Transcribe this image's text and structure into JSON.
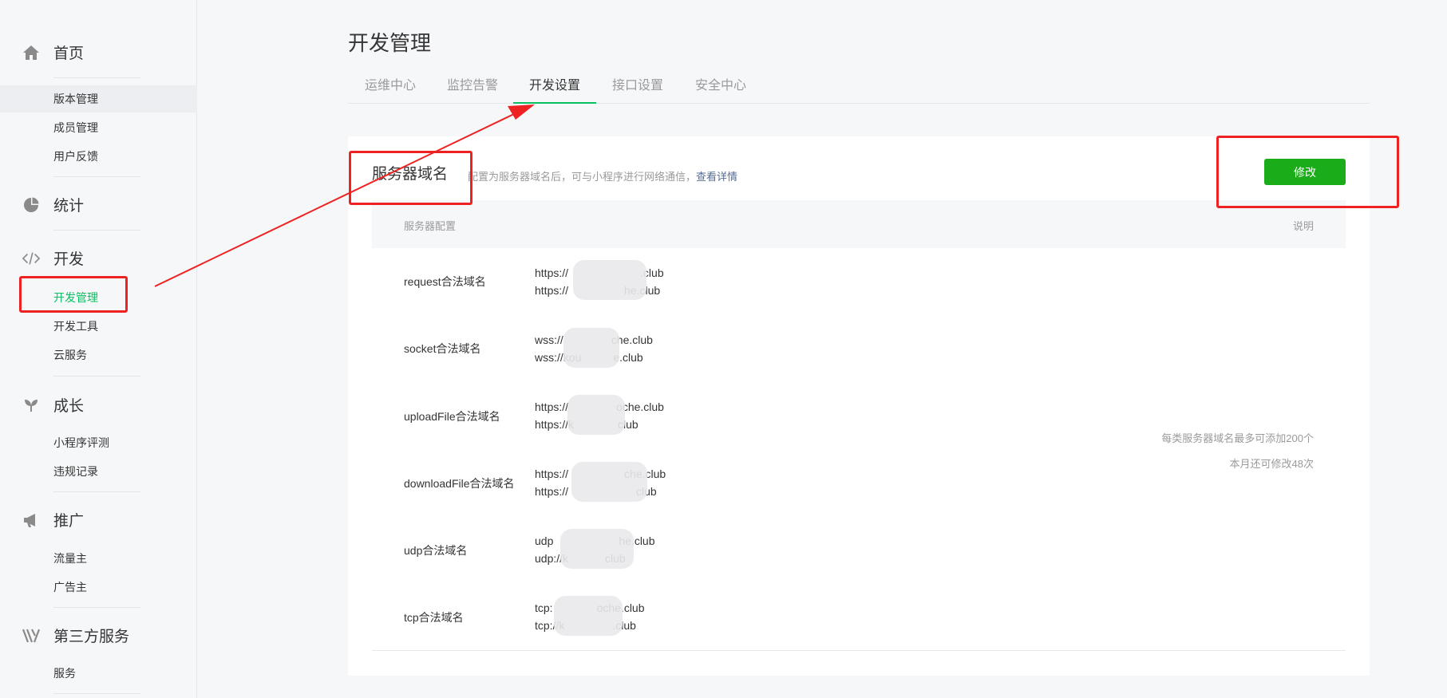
{
  "sidebar": {
    "groups": [
      {
        "title": "首页",
        "icon": "home-icon",
        "items": [
          {
            "label": "版本管理"
          },
          {
            "label": "成员管理"
          },
          {
            "label": "用户反馈"
          }
        ]
      },
      {
        "title": "统计",
        "icon": "pie-chart-icon",
        "items": []
      },
      {
        "title": "开发",
        "icon": "code-icon",
        "items": [
          {
            "label": "开发管理"
          },
          {
            "label": "开发工具"
          },
          {
            "label": "云服务"
          }
        ]
      },
      {
        "title": "成长",
        "icon": "sprout-icon",
        "items": [
          {
            "label": "小程序评测"
          },
          {
            "label": "违规记录"
          }
        ]
      },
      {
        "title": "推广",
        "icon": "megaphone-icon",
        "items": [
          {
            "label": "流量主"
          },
          {
            "label": "广告主"
          }
        ]
      },
      {
        "title": "第三方服务",
        "icon": "third-party-icon",
        "items": [
          {
            "label": "服务"
          }
        ]
      }
    ],
    "active_item": "开发管理"
  },
  "page": {
    "title": "开发管理",
    "tabs": [
      "运维中心",
      "监控告警",
      "开发设置",
      "接口设置",
      "安全中心"
    ],
    "active_tab": "开发设置"
  },
  "server_domain": {
    "title": "服务器域名",
    "desc": "配置为服务器域名后，可与小程序进行网络通信，",
    "desc_link": "查看详情",
    "edit_button": "修改",
    "col_config": "服务器配置",
    "col_note": "说明",
    "rows": [
      {
        "label": "request合法域名",
        "values": [
          "https://",
          ".club",
          "https://",
          "he.club"
        ]
      },
      {
        "label": "socket合法域名",
        "values": [
          "wss://",
          "che.club",
          "wss://kou",
          "e.club"
        ]
      },
      {
        "label": "uploadFile合法域名",
        "values": [
          "https://",
          "oche.club",
          "https://k",
          "club"
        ]
      },
      {
        "label": "downloadFile合法域名",
        "values": [
          "https://",
          "che.club",
          "https://",
          "club"
        ]
      },
      {
        "label": "udp合法域名",
        "values": [
          "udp",
          "he.club",
          "udp://k",
          "club"
        ]
      },
      {
        "label": "tcp合法域名",
        "values": [
          "tcp:",
          "oche.club",
          "tcp://k",
          ".club"
        ]
      }
    ],
    "note_line1": "每类服务器域名最多可添加200个",
    "note_line2": "本月还可修改48次"
  },
  "colors": {
    "accent_green": "#07c160",
    "button_green": "#1aad19",
    "link_blue": "#576b95",
    "annotation_red": "#ee2222"
  }
}
